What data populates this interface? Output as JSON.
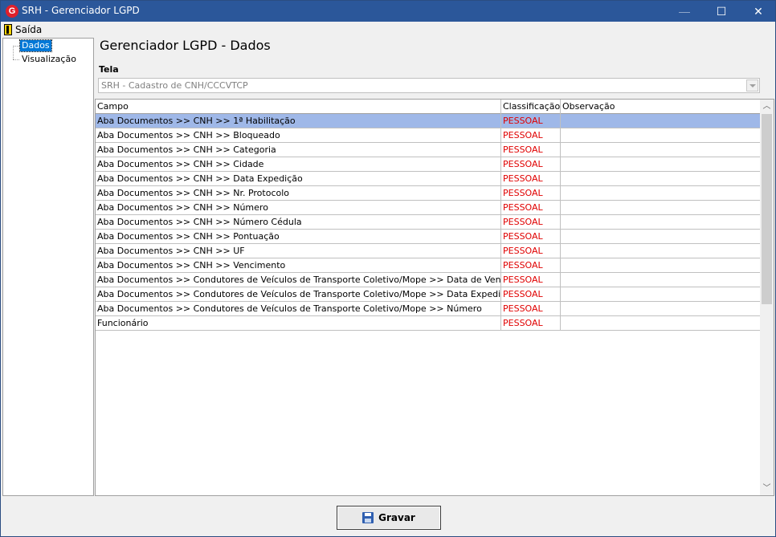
{
  "window": {
    "title": "SRH - Gerenciador LGPD",
    "logo_letter": "G",
    "controls": {
      "minimize": "—",
      "maximize": "☐",
      "close": "✕"
    }
  },
  "menu": {
    "items": [
      {
        "label": "Saída",
        "icon": "exit-door-icon"
      }
    ]
  },
  "tree": {
    "items": [
      {
        "label": "Dados",
        "selected": true
      },
      {
        "label": "Visualização",
        "selected": false
      }
    ]
  },
  "main": {
    "title": "Gerenciador LGPD - Dados",
    "tela_label": "Tela",
    "tela_value": "SRH - Cadastro de CNH/CCCVTCP"
  },
  "grid": {
    "columns": [
      "Campo",
      "Classificação",
      "Observação"
    ],
    "rows": [
      {
        "campo": "Aba Documentos >> CNH >> 1ª Habilitação",
        "classificacao": "PESSOAL",
        "observacao": ""
      },
      {
        "campo": "Aba Documentos >> CNH >> Bloqueado",
        "classificacao": "PESSOAL",
        "observacao": ""
      },
      {
        "campo": "Aba Documentos >> CNH >> Categoria",
        "classificacao": "PESSOAL",
        "observacao": ""
      },
      {
        "campo": "Aba Documentos >> CNH >> Cidade",
        "classificacao": "PESSOAL",
        "observacao": ""
      },
      {
        "campo": "Aba Documentos >> CNH >> Data Expedição",
        "classificacao": "PESSOAL",
        "observacao": ""
      },
      {
        "campo": "Aba Documentos >> CNH >> Nr. Protocolo",
        "classificacao": "PESSOAL",
        "observacao": ""
      },
      {
        "campo": "Aba Documentos >> CNH >> Número",
        "classificacao": "PESSOAL",
        "observacao": ""
      },
      {
        "campo": "Aba Documentos >> CNH >> Número Cédula",
        "classificacao": "PESSOAL",
        "observacao": ""
      },
      {
        "campo": "Aba Documentos >> CNH >> Pontuação",
        "classificacao": "PESSOAL",
        "observacao": ""
      },
      {
        "campo": "Aba Documentos >> CNH >> UF",
        "classificacao": "PESSOAL",
        "observacao": ""
      },
      {
        "campo": "Aba Documentos >> CNH >> Vencimento",
        "classificacao": "PESSOAL",
        "observacao": ""
      },
      {
        "campo": "Aba Documentos >> Condutores de Veículos de Transporte Coletivo/Mope >> Data de Vencimento",
        "classificacao": "PESSOAL",
        "observacao": ""
      },
      {
        "campo": "Aba Documentos >> Condutores de Veículos de Transporte Coletivo/Mope >> Data Expedição",
        "classificacao": "PESSOAL",
        "observacao": ""
      },
      {
        "campo": "Aba Documentos >> Condutores de Veículos de Transporte Coletivo/Mope >> Número",
        "classificacao": "PESSOAL",
        "observacao": ""
      },
      {
        "campo": "Funcionário",
        "classificacao": "PESSOAL",
        "observacao": ""
      }
    ],
    "selected_row": 0
  },
  "footer": {
    "save_label": "Gravar",
    "save_icon": "floppy-disk-icon"
  },
  "colors": {
    "titlebar": "#2b579a",
    "selection": "#0078d7",
    "row_selected": "#9fb8e8",
    "classification_text": "#e00000"
  }
}
